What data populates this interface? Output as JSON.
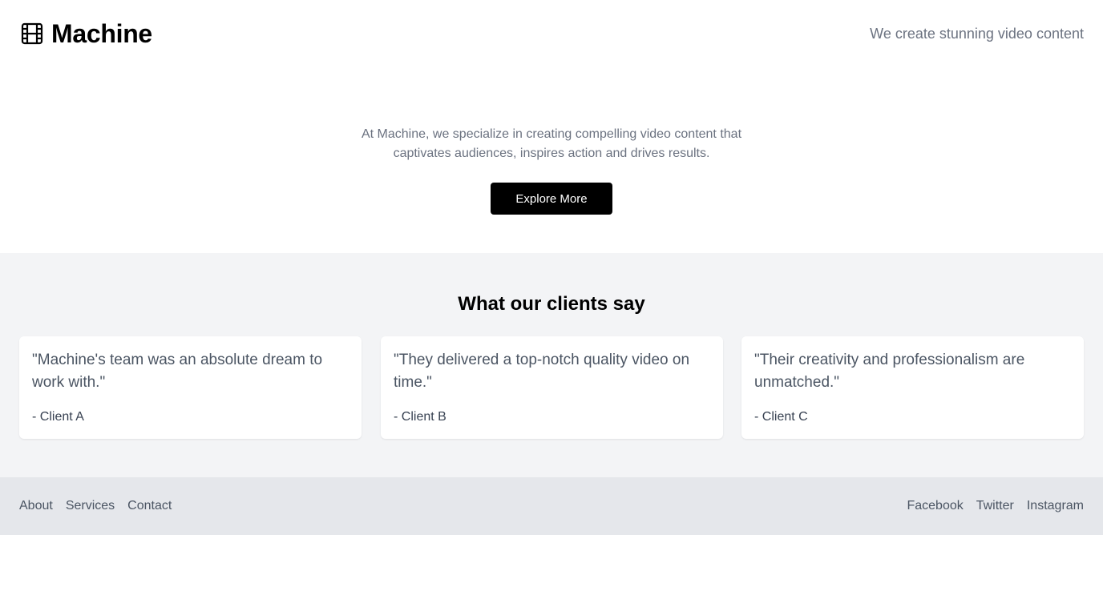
{
  "header": {
    "brand_icon": "film-icon",
    "brand_name": "Machine",
    "tagline": "We create stunning video content"
  },
  "hero": {
    "description": "At Machine, we specialize in creating compelling video content that captivates audiences, inspires action and drives results.",
    "cta_label": "Explore More"
  },
  "testimonials": {
    "title": "What our clients say",
    "items": [
      {
        "quote": "\"Machine's team was an absolute dream to work with.\"",
        "author": "- Client A"
      },
      {
        "quote": "\"They delivered a top-notch quality video on time.\"",
        "author": "- Client B"
      },
      {
        "quote": "\"Their creativity and professionalism are unmatched.\"",
        "author": "- Client C"
      }
    ]
  },
  "footer": {
    "links": [
      "About",
      "Services",
      "Contact"
    ],
    "social": [
      "Facebook",
      "Twitter",
      "Instagram"
    ]
  },
  "colors": {
    "accent": "#000000",
    "muted_text": "#6b7280",
    "section_bg": "#f3f4f6",
    "footer_bg": "#e5e7eb"
  }
}
